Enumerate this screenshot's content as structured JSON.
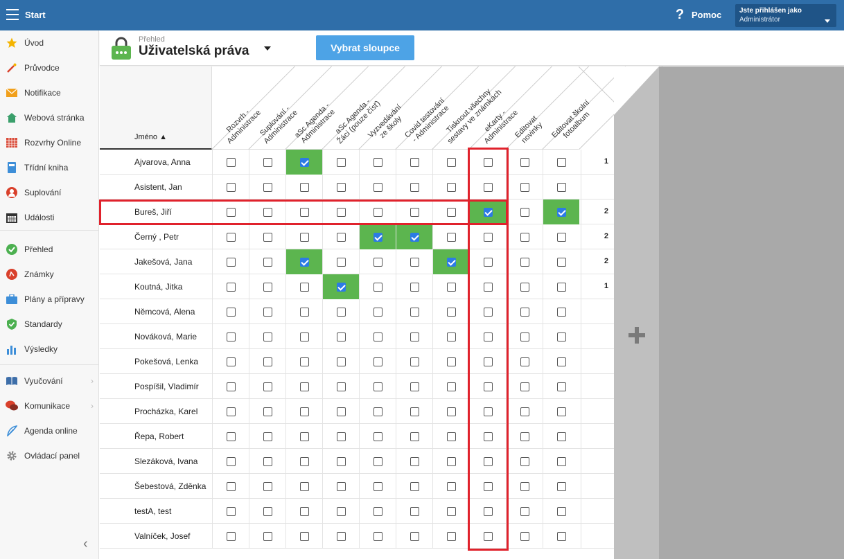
{
  "topbar": {
    "start_label": "Start",
    "help_label": "Pomoc",
    "user_line1": "Jste přihlášen jako",
    "user_line2": "Administrátor"
  },
  "sidebar": {
    "items": [
      {
        "label": "Úvod",
        "icon": "star-icon",
        "color": "#f4b400"
      },
      {
        "label": "Průvodce",
        "icon": "magic-wand-icon",
        "color": "#d9402b"
      },
      {
        "label": "Notifikace",
        "icon": "envelope-icon",
        "color": "#f1a01c"
      },
      {
        "label": "Webová stránka",
        "icon": "house-icon",
        "color": "#3a9f6b"
      },
      {
        "label": "Rozvrhy Online",
        "icon": "grid-calendar-icon",
        "color": "#d94c3a"
      },
      {
        "label": "Třídní kniha",
        "icon": "book-icon",
        "color": "#3d8ed8"
      },
      {
        "label": "Suplování",
        "icon": "person-icon",
        "color": "#d9402b"
      },
      {
        "label": "Události",
        "icon": "calendar-icon",
        "color": "#333333"
      },
      {
        "label": "Přehled",
        "icon": "check-circle-icon",
        "color": "#4cb050"
      },
      {
        "label": "Známky",
        "icon": "grade-circle-icon",
        "color": "#d9402b"
      },
      {
        "label": "Plány a přípravy",
        "icon": "briefcase-icon",
        "color": "#3d8ed8"
      },
      {
        "label": "Standardy",
        "icon": "shield-check-icon",
        "color": "#4cb050"
      },
      {
        "label": "Výsledky",
        "icon": "bar-chart-icon",
        "color": "#3d8ed8"
      },
      {
        "label": "Vyučování",
        "icon": "open-book-icon",
        "color": "#3d6ea9"
      },
      {
        "label": "Komunikace",
        "icon": "chat-icon",
        "color": "#d9402b"
      },
      {
        "label": "Agenda online",
        "icon": "feather-icon",
        "color": "#3d8ed8"
      },
      {
        "label": "Ovládací panel",
        "icon": "gear-icon",
        "color": "#888888"
      }
    ]
  },
  "header": {
    "breadcrumb": "Přehled",
    "title": "Uživatelská práva",
    "choose_columns": "Vybrat sloupce"
  },
  "table": {
    "name_header": "Jméno ▲",
    "columns": [
      [
        "Rozvrh -",
        "Administrace"
      ],
      [
        "Suplování -",
        "Administrace"
      ],
      [
        "aSc Agenda -",
        "Administrace"
      ],
      [
        "aSc Agenda -",
        "Žáci (pouze čísť)"
      ],
      [
        "Vyzvedávání",
        "ze školy"
      ],
      [
        "Covid testování",
        "- Administrace"
      ],
      [
        "Tisknout všechny",
        "sestavy ve známkách"
      ],
      [
        "eKarty -",
        "Administrace"
      ],
      [
        "Editovat",
        "novinky"
      ],
      [
        "Editovat školní",
        "fotoalbum"
      ]
    ],
    "rows": [
      {
        "name": "Ajvarova, Anna",
        "checked": [
          2
        ],
        "count": "1"
      },
      {
        "name": "Asistent, Jan",
        "checked": [],
        "count": ""
      },
      {
        "name": "Bureš, Jiří",
        "checked": [
          7,
          9
        ],
        "count": "2"
      },
      {
        "name": "Černý , Petr",
        "checked": [
          4,
          5
        ],
        "count": "2"
      },
      {
        "name": "Jakešová, Jana",
        "checked": [
          2,
          6
        ],
        "count": "2"
      },
      {
        "name": "Koutná, Jitka",
        "checked": [
          3
        ],
        "count": "1"
      },
      {
        "name": "Němcová, Alena",
        "checked": [],
        "count": ""
      },
      {
        "name": "Nováková, Marie",
        "checked": [],
        "count": ""
      },
      {
        "name": "Pokešová, Lenka",
        "checked": [],
        "count": ""
      },
      {
        "name": "Pospíšil, Vladimír",
        "checked": [],
        "count": ""
      },
      {
        "name": "Procházka, Karel",
        "checked": [],
        "count": ""
      },
      {
        "name": "Řepa, Robert",
        "checked": [],
        "count": ""
      },
      {
        "name": "Slezáková, Ivana",
        "checked": [],
        "count": ""
      },
      {
        "name": "Šebestová, Zděnka",
        "checked": [],
        "count": ""
      },
      {
        "name": "testA, test",
        "checked": [],
        "count": ""
      },
      {
        "name": "Valníček, Josef",
        "checked": [],
        "count": ""
      }
    ]
  },
  "colors": {
    "topbar": "#2f6ea9",
    "checked_cell": "#5cb54f",
    "checkbox_checked": "#2c7be5",
    "highlight": "#e0222c",
    "button": "#4da3e6"
  }
}
